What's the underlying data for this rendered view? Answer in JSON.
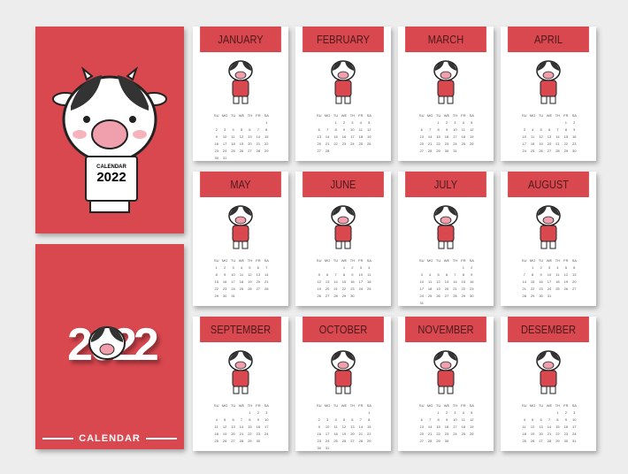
{
  "cover": {
    "sign_label": "CALENDAR",
    "sign_year": "2022",
    "year": "2022",
    "footer": "CALENDAR"
  },
  "weekdays": [
    "SU",
    "MO",
    "TU",
    "WE",
    "TH",
    "FR",
    "SA"
  ],
  "months": [
    {
      "name": "JANUARY",
      "start": 6,
      "days": 31
    },
    {
      "name": "FEBRUARY",
      "start": 2,
      "days": 28
    },
    {
      "name": "MARCH",
      "start": 2,
      "days": 31
    },
    {
      "name": "APRIL",
      "start": 5,
      "days": 30
    },
    {
      "name": "MAY",
      "start": 0,
      "days": 31
    },
    {
      "name": "JUNE",
      "start": 3,
      "days": 30
    },
    {
      "name": "JULY",
      "start": 5,
      "days": 31
    },
    {
      "name": "AUGUST",
      "start": 1,
      "days": 31
    },
    {
      "name": "SEPTEMBER",
      "start": 4,
      "days": 30
    },
    {
      "name": "OCTOBER",
      "start": 6,
      "days": 31
    },
    {
      "name": "NOVEMBER",
      "start": 2,
      "days": 30
    },
    {
      "name": "DESEMBER",
      "start": 4,
      "days": 31
    }
  ],
  "colors": {
    "accent": "#d9474f",
    "header_text": "#4a1a1c"
  }
}
